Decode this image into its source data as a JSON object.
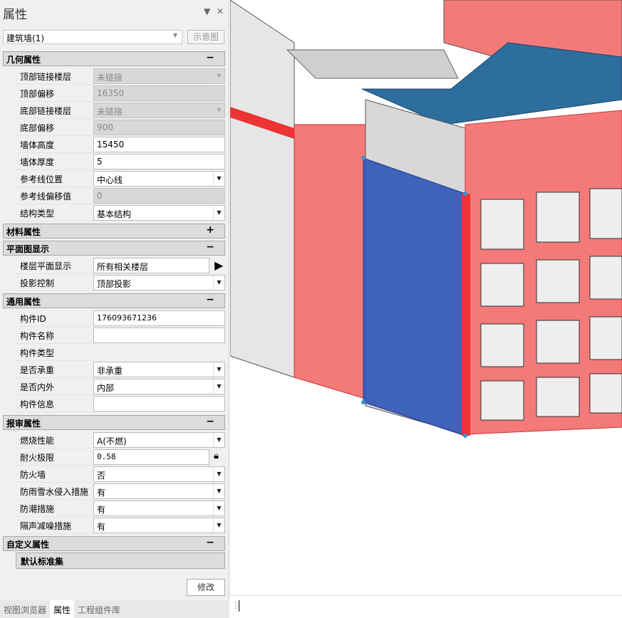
{
  "panel": {
    "title": "属性",
    "type_selector": "建筑墙(1)",
    "diagram_button": "示意图"
  },
  "groups": {
    "geometry": {
      "title": "几何属性",
      "toggle": "−",
      "rows": [
        {
          "label": "顶部链接楼层",
          "value": "未链接"
        },
        {
          "label": "顶部偏移",
          "value": "16350"
        },
        {
          "label": "底部链接楼层",
          "value": "未链接"
        },
        {
          "label": "底部偏移",
          "value": "900"
        },
        {
          "label": "墙体高度",
          "value": "15450"
        },
        {
          "label": "墙体厚度",
          "value": "5"
        },
        {
          "label": "参考线位置",
          "value": "中心线"
        },
        {
          "label": "参考线偏移值",
          "value": "0"
        },
        {
          "label": "结构类型",
          "value": "基本结构"
        }
      ]
    },
    "material": {
      "title": "材料属性",
      "toggle": "+"
    },
    "plan": {
      "title": "平面图显示",
      "toggle": "−",
      "rows": [
        {
          "label": "楼层平面显示",
          "value": "所有相关楼层"
        },
        {
          "label": "投影控制",
          "value": "顶部投影"
        }
      ]
    },
    "general": {
      "title": "通用属性",
      "toggle": "−",
      "rows": [
        {
          "label": "构件ID",
          "value": "176093671236"
        },
        {
          "label": "构件名称",
          "value": ""
        },
        {
          "label": "构件类型",
          "value": ""
        },
        {
          "label": "是否承重",
          "value": "非承重"
        },
        {
          "label": "是否内外",
          "value": "内部"
        },
        {
          "label": "构件信息",
          "value": ""
        }
      ]
    },
    "review": {
      "title": "报审属性",
      "toggle": "−",
      "rows": [
        {
          "label": "燃烧性能",
          "value": "A(不燃)"
        },
        {
          "label": "耐火极限",
          "value": "0.58"
        },
        {
          "label": "防火墙",
          "value": "否"
        },
        {
          "label": "防雨雪水侵入措施",
          "value": "有"
        },
        {
          "label": "防潮措施",
          "value": "有"
        },
        {
          "label": "隔声减噪措施",
          "value": "有"
        }
      ]
    },
    "custom": {
      "title": "自定义属性",
      "toggle": "−",
      "subgroup": "默认标准集"
    }
  },
  "modify_button": "修改",
  "tabs": [
    "视图浏览器",
    "属性",
    "工程组件库"
  ],
  "colors": {
    "wall_red": "#f26b6b",
    "selected_blue": "#2f55b8",
    "roof_blue": "#2e6e9e"
  }
}
